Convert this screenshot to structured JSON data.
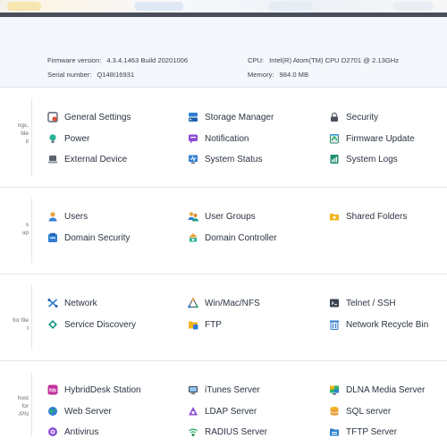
{
  "system_info": {
    "firmware_label": "Firmware version:",
    "firmware_value": "4.3.4.1463 Build 20201006",
    "serial_label": "Serial number:",
    "serial_value": "Q148I16931",
    "cpu_label": "CPU:",
    "cpu_value": "Intel(R) Atom(TM) CPU D2701 @ 2.13GHz",
    "memory_label": "Memory:",
    "memory_value": "984.0 MB"
  },
  "sections": {
    "system": {
      "desc": [
        "ngs,",
        "ble",
        "it"
      ],
      "items": [
        {
          "label": "General Settings",
          "icon": "general-settings-icon"
        },
        {
          "label": "Storage Manager",
          "icon": "storage-manager-icon"
        },
        {
          "label": "Security",
          "icon": "lock-icon"
        },
        {
          "label": "Power",
          "icon": "power-bulb-icon"
        },
        {
          "label": "Notification",
          "icon": "notification-icon"
        },
        {
          "label": "Firmware Update",
          "icon": "firmware-update-icon"
        },
        {
          "label": "External Device",
          "icon": "external-device-icon"
        },
        {
          "label": "System Status",
          "icon": "system-status-icon"
        },
        {
          "label": "System Logs",
          "icon": "system-logs-icon"
        }
      ]
    },
    "privilege": {
      "desc": [
        "s",
        "up"
      ],
      "items": [
        {
          "label": "Users",
          "icon": "user-icon"
        },
        {
          "label": "User Groups",
          "icon": "user-groups-icon"
        },
        {
          "label": "Shared Folders",
          "icon": "shared-folders-icon"
        },
        {
          "label": "Domain Security",
          "icon": "domain-security-icon"
        },
        {
          "label": "Domain Controller",
          "icon": "domain-controller-icon"
        }
      ]
    },
    "network": {
      "desc": [
        "for file",
        "t"
      ],
      "items": [
        {
          "label": "Network",
          "icon": "network-icon"
        },
        {
          "label": "Win/Mac/NFS",
          "icon": "win-mac-nfs-icon"
        },
        {
          "label": "Telnet / SSH",
          "icon": "terminal-icon"
        },
        {
          "label": "Service Discovery",
          "icon": "service-discovery-icon"
        },
        {
          "label": "FTP",
          "icon": "ftp-icon"
        },
        {
          "label": "Network Recycle Bin",
          "icon": "recycle-bin-icon"
        }
      ]
    },
    "applications": {
      "desc": [
        "host",
        "for",
        "/PN"
      ],
      "items": [
        {
          "label": "HybridDesk Station",
          "icon": "hybriddesk-icon"
        },
        {
          "label": "iTunes Server",
          "icon": "itunes-server-icon"
        },
        {
          "label": "DLNA Media Server",
          "icon": "dlna-media-server-icon"
        },
        {
          "label": "Web Server",
          "icon": "web-server-icon"
        },
        {
          "label": "LDAP Server",
          "icon": "ldap-server-icon"
        },
        {
          "label": "SQL server",
          "icon": "sql-server-icon"
        },
        {
          "label": "Antivirus",
          "icon": "antivirus-icon"
        },
        {
          "label": "RADIUS Server",
          "icon": "radius-server-icon"
        },
        {
          "label": "TFTP Server",
          "icon": "tftp-server-icon"
        }
      ]
    }
  },
  "colors": {
    "top_bar": "#4a4e5a",
    "info_bg": "#f5f7fc",
    "text": "#2a3340",
    "divider": "#e3e6eb"
  }
}
